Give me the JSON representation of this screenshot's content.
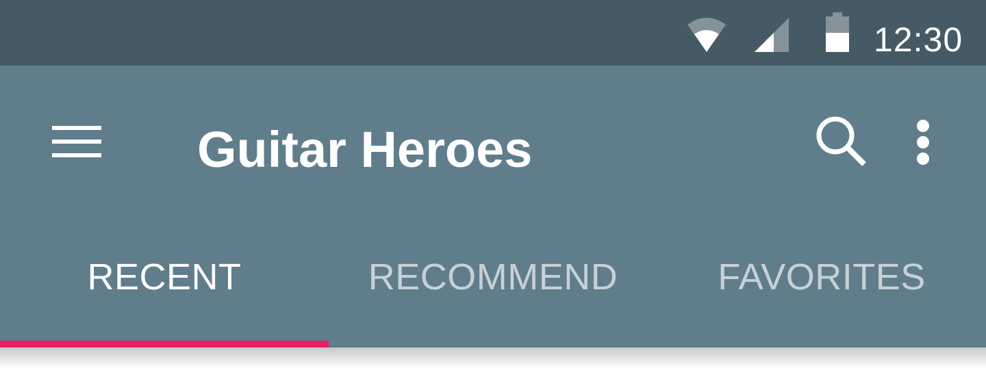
{
  "status_bar": {
    "time": "12:30",
    "icons": [
      "wifi-icon",
      "cellular-signal-icon",
      "battery-icon"
    ]
  },
  "app_bar": {
    "title": "Guitar Heroes",
    "nav_icon": "hamburger-menu-icon",
    "actions": [
      "search-icon",
      "more-vert-icon"
    ]
  },
  "tabs": [
    {
      "label": "RECENT",
      "active": true
    },
    {
      "label": "RECOMMEND",
      "active": false
    },
    {
      "label": "FAVORITES",
      "active": false
    }
  ],
  "colors": {
    "status_bar": "#455a64",
    "app_bar": "#607d8b",
    "accent": "#e91e63",
    "text": "#ffffff"
  }
}
